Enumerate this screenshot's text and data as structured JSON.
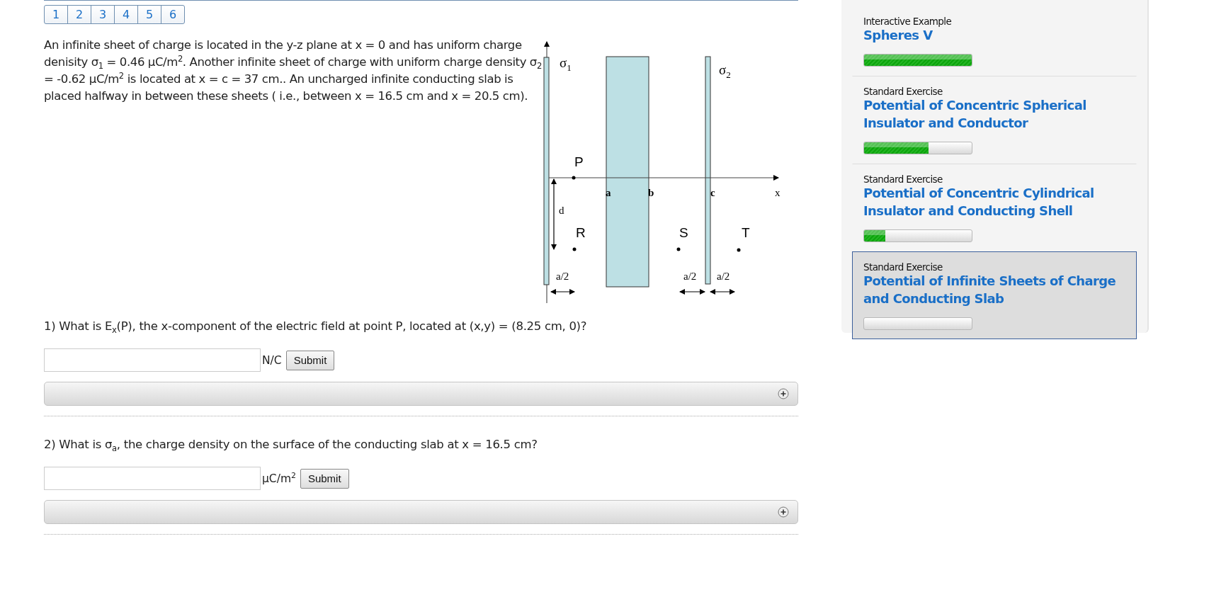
{
  "pages": [
    {
      "label": "1"
    },
    {
      "label": "2"
    },
    {
      "label": "3"
    },
    {
      "label": "4"
    },
    {
      "label": "5"
    },
    {
      "label": "6"
    }
  ],
  "problem": "An infinite sheet of charge is located in the y-z plane at x = 0 and has uniform charge denisity σ$_{1}$ = 0.46 μC/m$^{2}$. Another infinite sheet of charge with uniform charge density σ$_{2}$ = -0.62 μC/m$^{2}$ is located at x = c = 37 cm.. An uncharged infinite conducting slab is placed halfway in between these sheets ( i.e., between x = 16.5 cm and x = 20.5 cm).",
  "diagram": {
    "labels": [
      {
        "kind": "sigma",
        "text": "σ",
        "sub": "1"
      },
      {
        "kind": "sigma",
        "text": "σ",
        "sub": "2"
      },
      {
        "kind": "point",
        "text": "P"
      },
      {
        "kind": "serif",
        "text": "a"
      },
      {
        "kind": "serif",
        "text": "b"
      },
      {
        "kind": "serif",
        "text": "c"
      },
      {
        "kind": "serif",
        "text": "x"
      },
      {
        "kind": "serif",
        "text": "d"
      },
      {
        "kind": "point",
        "text": "R"
      },
      {
        "kind": "point",
        "text": "S"
      },
      {
        "kind": "point",
        "text": "T"
      },
      {
        "kind": "serif",
        "text": "a/2"
      },
      {
        "kind": "serif",
        "text": "a/2"
      },
      {
        "kind": "serif",
        "text": "a/2"
      }
    ]
  },
  "questions": [
    {
      "text": "1) What is E$_{x}$(P), the x-component of the electric field at point P, located at (x,y) = (8.25 cm, 0)?",
      "unit": "N/C",
      "button": "Submit"
    },
    {
      "text": "2) What is σ$_{a}$, the charge density on the surface of the conducting slab at x = 16.5 cm?",
      "unit": "μC/m$^{2}$",
      "button": "Submit"
    }
  ],
  "sidebar": {
    "items": [
      {
        "type": "Interactive Example",
        "title": "Spheres V",
        "level": 1,
        "selected": false
      },
      {
        "type": "Standard Exercise",
        "title": "Potential of Concentric Spherical Insulator and Conductor",
        "level": 0.6,
        "selected": false
      },
      {
        "type": "Standard Exercise",
        "title": "Potential of Concentric Cylindrical Insulator and Conducting Shell",
        "level": 0.2,
        "selected": false
      },
      {
        "type": "Standard Exercise",
        "title": "Potential of Infinite Sheets of Charge and Conducting Slab",
        "level": 0,
        "selected": true
      }
    ]
  }
}
